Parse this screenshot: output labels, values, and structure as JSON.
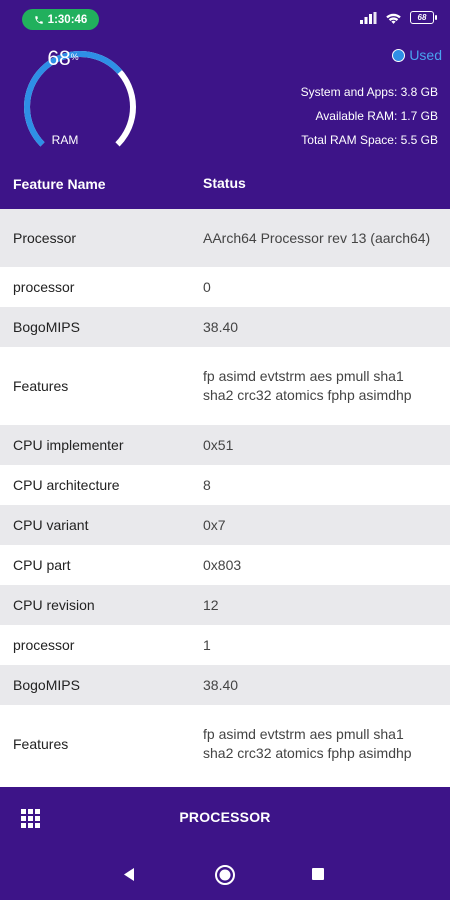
{
  "status_bar": {
    "call_time": "1:30:46",
    "battery": "68"
  },
  "ram": {
    "percent": "68",
    "percent_sign": "%",
    "label": "RAM",
    "used_fraction": 0.68,
    "legend": "Used",
    "stats": [
      "System and Apps: 3.8 GB",
      "Available RAM: 1.7 GB",
      "Total RAM Space: 5.5 GB"
    ]
  },
  "table": {
    "headers": {
      "name": "Feature Name",
      "status": "Status"
    },
    "rows": [
      {
        "name": "Processor",
        "status": "AArch64 Processor rev 13 (aarch64)"
      },
      {
        "name": "processor",
        "status": "0"
      },
      {
        "name": "BogoMIPS",
        "status": "38.40"
      },
      {
        "name": "Features",
        "status": "fp asimd evtstrm aes pmull sha1 sha2 crc32 atomics fphp asimdhp"
      },
      {
        "name": "CPU implementer",
        "status": "0x51"
      },
      {
        "name": "CPU architecture",
        "status": "8"
      },
      {
        "name": "CPU variant",
        "status": "0x7"
      },
      {
        "name": "CPU part",
        "status": "0x803"
      },
      {
        "name": "CPU revision",
        "status": "12"
      },
      {
        "name": "processor",
        "status": "1"
      },
      {
        "name": "BogoMIPS",
        "status": "38.40"
      },
      {
        "name": "Features",
        "status": "fp asimd evtstrm aes pmull sha1 sha2 crc32 atomics fphp asimdhp"
      }
    ]
  },
  "bottom_bar": {
    "title": "PROCESSOR",
    "menu_icon": "grid-icon"
  },
  "nav": {
    "back": "back-icon",
    "home": "home-icon",
    "recents": "recents-icon"
  },
  "colors": {
    "primary": "#3d1488",
    "accent": "#2e8fe6",
    "call_pill": "#21b05d",
    "row_alt": "#e9e9ec"
  }
}
